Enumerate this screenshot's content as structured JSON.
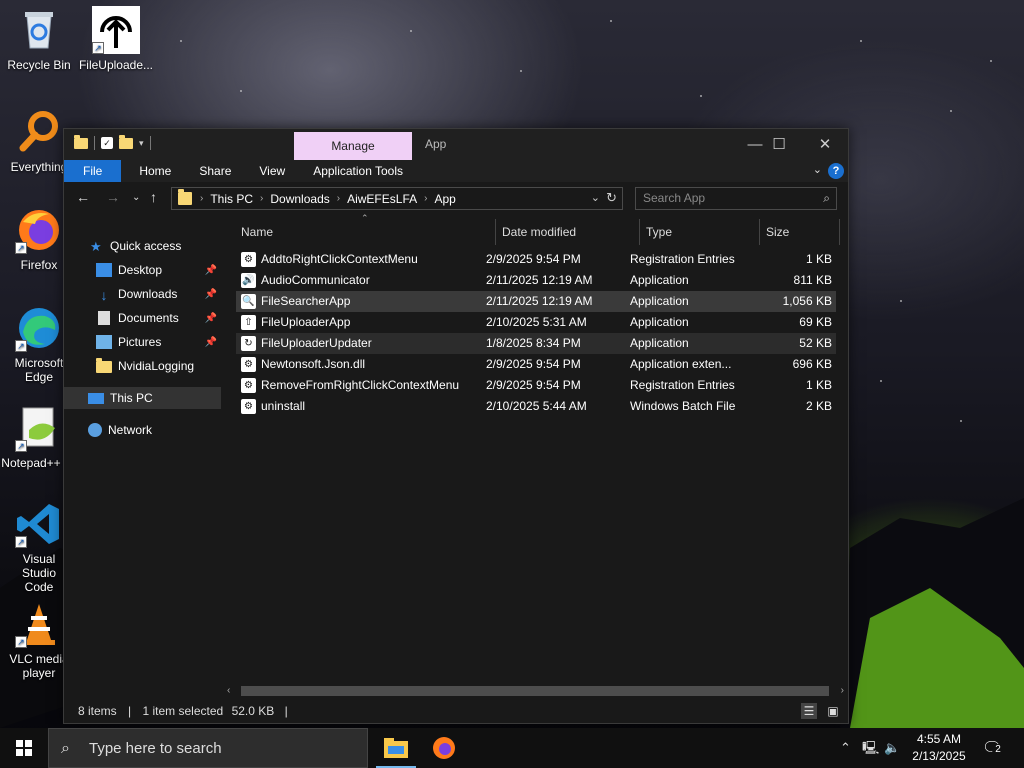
{
  "desktop": {
    "icons": [
      {
        "label": "Recycle Bin",
        "icon": "recycle-bin-icon"
      },
      {
        "label": "FileUploade...",
        "icon": "upload-arrow-icon"
      },
      {
        "label": "Everything",
        "icon": "magnifier-icon"
      },
      {
        "label": "Firefox",
        "icon": "firefox-icon"
      },
      {
        "label": "Microsoft Edge",
        "icon": "edge-icon"
      },
      {
        "label": "Notepad++",
        "icon": "notepad-plus-icon"
      },
      {
        "label": "Visual Studio Code",
        "icon": "vscode-icon"
      },
      {
        "label": "VLC media player",
        "icon": "vlc-cone-icon"
      }
    ]
  },
  "window": {
    "manage_tab": "Manage",
    "title": "App",
    "ribbon_tabs": [
      "File",
      "Home",
      "Share",
      "View",
      "Application Tools"
    ],
    "help": "?",
    "address": {
      "crumbs": [
        "This PC",
        "Downloads",
        "AiwEFEsLFA",
        "App"
      ]
    },
    "search_placeholder": "Search App",
    "nav": {
      "quick_access": "Quick access",
      "items": [
        "Desktop",
        "Downloads",
        "Documents",
        "Pictures",
        "NvidiaLogging"
      ],
      "this_pc": "This PC",
      "network": "Network"
    },
    "columns": [
      "Name",
      "Date modified",
      "Type",
      "Size"
    ],
    "files": [
      {
        "name": "AddtoRightClickContextMenu",
        "date": "2/9/2025 9:54 PM",
        "type": "Registration Entries",
        "size": "1 KB",
        "icon": "registry-icon"
      },
      {
        "name": "AudioCommunicator",
        "date": "2/11/2025 12:19 AM",
        "type": "Application",
        "size": "811 KB",
        "icon": "speaker-icon"
      },
      {
        "name": "FileSearcherApp",
        "date": "2/11/2025 12:19 AM",
        "type": "Application",
        "size": "1,056 KB",
        "icon": "search-app-icon"
      },
      {
        "name": "FileUploaderApp",
        "date": "2/10/2025 5:31 AM",
        "type": "Application",
        "size": "69 KB",
        "icon": "upload-app-icon"
      },
      {
        "name": "FileUploaderUpdater",
        "date": "1/8/2025 8:34 PM",
        "type": "Application",
        "size": "52 KB",
        "icon": "updater-icon"
      },
      {
        "name": "Newtonsoft.Json.dll",
        "date": "2/9/2025 9:54 PM",
        "type": "Application exten...",
        "size": "696 KB",
        "icon": "dll-icon"
      },
      {
        "name": "RemoveFromRightClickContextMenu",
        "date": "2/9/2025 9:54 PM",
        "type": "Registration Entries",
        "size": "1 KB",
        "icon": "registry-icon"
      },
      {
        "name": "uninstall",
        "date": "2/10/2025 5:44 AM",
        "type": "Windows Batch File",
        "size": "2 KB",
        "icon": "batch-file-icon"
      }
    ],
    "status": {
      "items": "8 items",
      "sep": "|",
      "selected": "1 item selected",
      "size": "52.0 KB"
    }
  },
  "taskbar": {
    "search_placeholder": "Type here to search",
    "time": "4:55 AM",
    "date": "2/13/2025",
    "notifications": "2"
  }
}
